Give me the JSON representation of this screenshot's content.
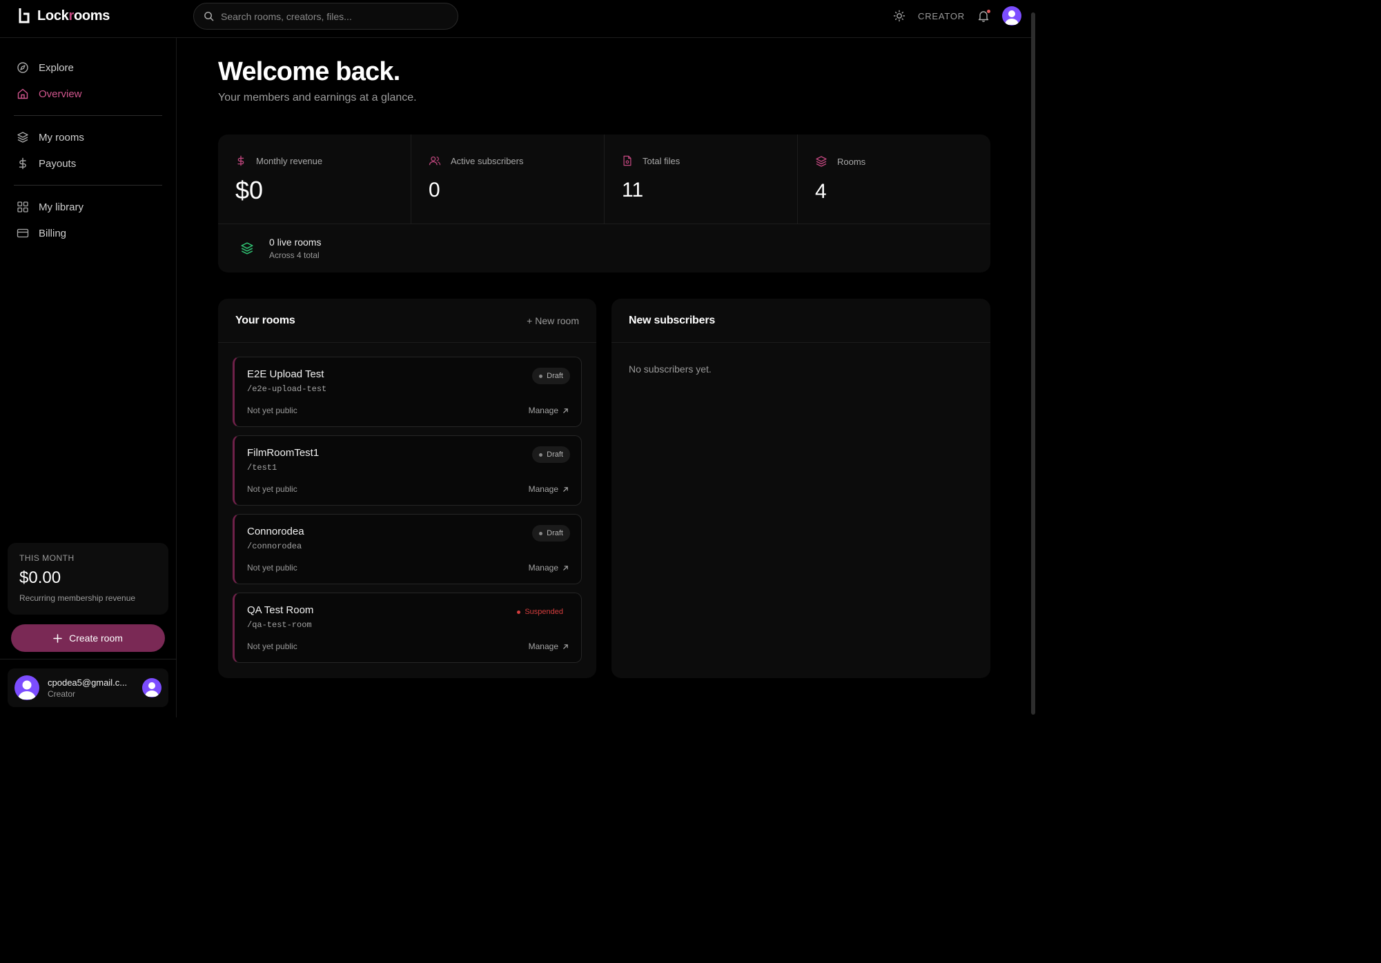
{
  "app": {
    "logo_text_before": "Lock",
    "logo_text_accent": "r",
    "logo_text_after": "ooms",
    "accent_color": "#c2477f"
  },
  "header": {
    "search_placeholder": "Search rooms, creators, files...",
    "role_label": "CREATOR",
    "icons": [
      "search-icon",
      "sun-icon",
      "bell-icon",
      "avatar"
    ]
  },
  "sidebar": {
    "items": [
      {
        "label": "Explore",
        "icon": "compass-icon"
      },
      {
        "label": "Overview",
        "icon": "home-icon",
        "active": true
      },
      {
        "label": "My rooms",
        "icon": "layers-icon"
      },
      {
        "label": "Payouts",
        "icon": "dollar-icon"
      },
      {
        "label": "My library",
        "icon": "grid-icon"
      },
      {
        "label": "Billing",
        "icon": "card-icon"
      }
    ],
    "month": {
      "label": "THIS MONTH",
      "value": "$0.00",
      "sub": "Recurring membership revenue"
    },
    "create_button": "Create room",
    "user": {
      "email": "cpodea5@gmail.c...",
      "role": "Creator"
    }
  },
  "main": {
    "title": "Welcome back.",
    "subtitle": "Your members and earnings at a glance.",
    "stats": [
      {
        "label": "Monthly revenue",
        "value": "$0",
        "icon": "dollar-icon"
      },
      {
        "label": "Active subscribers",
        "value": "0",
        "icon": "users-icon"
      },
      {
        "label": "Total files",
        "value": "11",
        "icon": "file-icon"
      },
      {
        "label": "Rooms",
        "value": "4",
        "icon": "layers-icon"
      }
    ],
    "live": {
      "title": "0 live rooms",
      "sub": "Across 4 total"
    },
    "rooms_panel": {
      "title": "Your rooms",
      "action": "+ New room",
      "rooms": [
        {
          "name": "E2E Upload Test",
          "slug": "/e2e-upload-test",
          "status": "Not yet public",
          "badge": "Draft",
          "manage": "Manage"
        },
        {
          "name": "FilmRoomTest1",
          "slug": "/test1",
          "status": "Not yet public",
          "badge": "Draft",
          "manage": "Manage"
        },
        {
          "name": "Connorodea",
          "slug": "/connorodea",
          "status": "Not yet public",
          "badge": "Draft",
          "manage": "Manage"
        },
        {
          "name": "QA Test Room",
          "slug": "/qa-test-room",
          "status": "Not yet public",
          "badge": "Suspended",
          "manage": "Manage"
        }
      ]
    },
    "subs_panel": {
      "title": "New subscribers",
      "empty": "No subscribers yet."
    }
  }
}
